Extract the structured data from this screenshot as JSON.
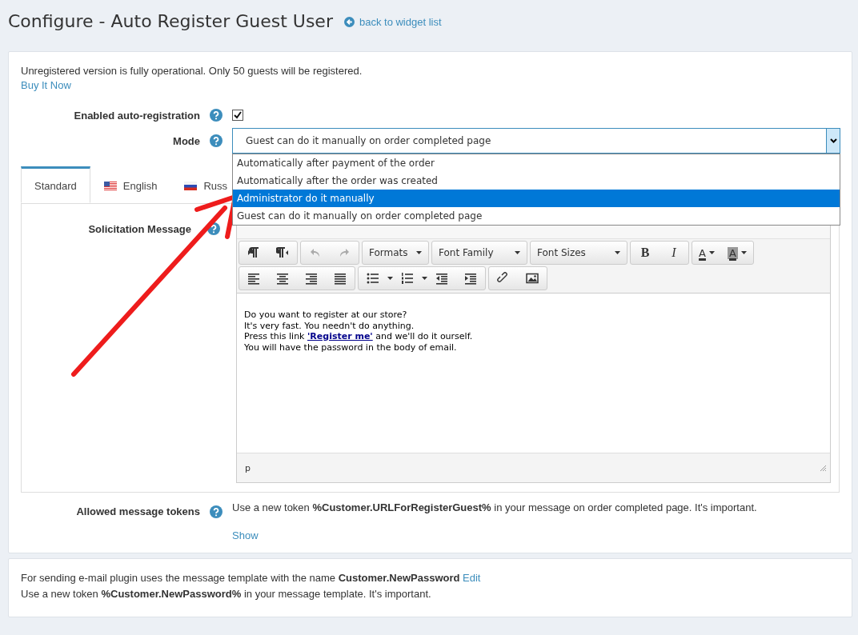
{
  "page": {
    "title": "Configure - Auto Register Guest User",
    "back_link": "back to widget list"
  },
  "notice": {
    "text": "Unregistered version is fully operational. Only 50 guests will be registered.",
    "link": "Buy It Now"
  },
  "enabled": {
    "label": "Enabled auto-registration",
    "checked": true
  },
  "mode": {
    "label": "Mode",
    "value": "Guest can do it manually on order completed page",
    "expanded": true,
    "options": [
      {
        "label": "Automatically after payment of the order",
        "highlighted": false
      },
      {
        "label": "Automatically after the order was created",
        "highlighted": false
      },
      {
        "label": "Administrator do it manually",
        "highlighted": true
      },
      {
        "label": "Guest can do it manually on order completed page",
        "highlighted": false
      }
    ]
  },
  "tabs": [
    {
      "label": "Standard",
      "selected": true,
      "kind": "plain"
    },
    {
      "label": "English",
      "selected": false,
      "kind": "us-flag"
    },
    {
      "label": "Russ",
      "selected": false,
      "kind": "ru-flag"
    }
  ],
  "message": {
    "label": "Solicitation Message",
    "toolbar": {
      "dropdowns": [
        "Formats",
        "Font Family",
        "Font Sizes"
      ],
      "bold": "B",
      "italic": "I",
      "text_color": "A",
      "background_color": "A"
    },
    "lines": [
      {
        "before": "Do you want to register at our store?"
      },
      {
        "before": "It's very fast. You needn't do anything."
      },
      {
        "before": "Press this link ",
        "link": "'Register me'",
        "after": " and we'll do it ourself."
      },
      {
        "before": "You will have the password in the body of email."
      }
    ],
    "status_path": "p"
  },
  "tokens": {
    "label": "Allowed message tokens",
    "text": "Use a new token **%Customer.URLForRegisterGuest%** in your message on order completed page. It's important.",
    "link": "Show"
  },
  "footer": {
    "line1": "For sending e-mail plugin uses the message template with the name **Customer.NewPassword**",
    "edit": "Edit",
    "line2": "Use a new token **%Customer.NewPassword%** in your message template. It's important."
  }
}
